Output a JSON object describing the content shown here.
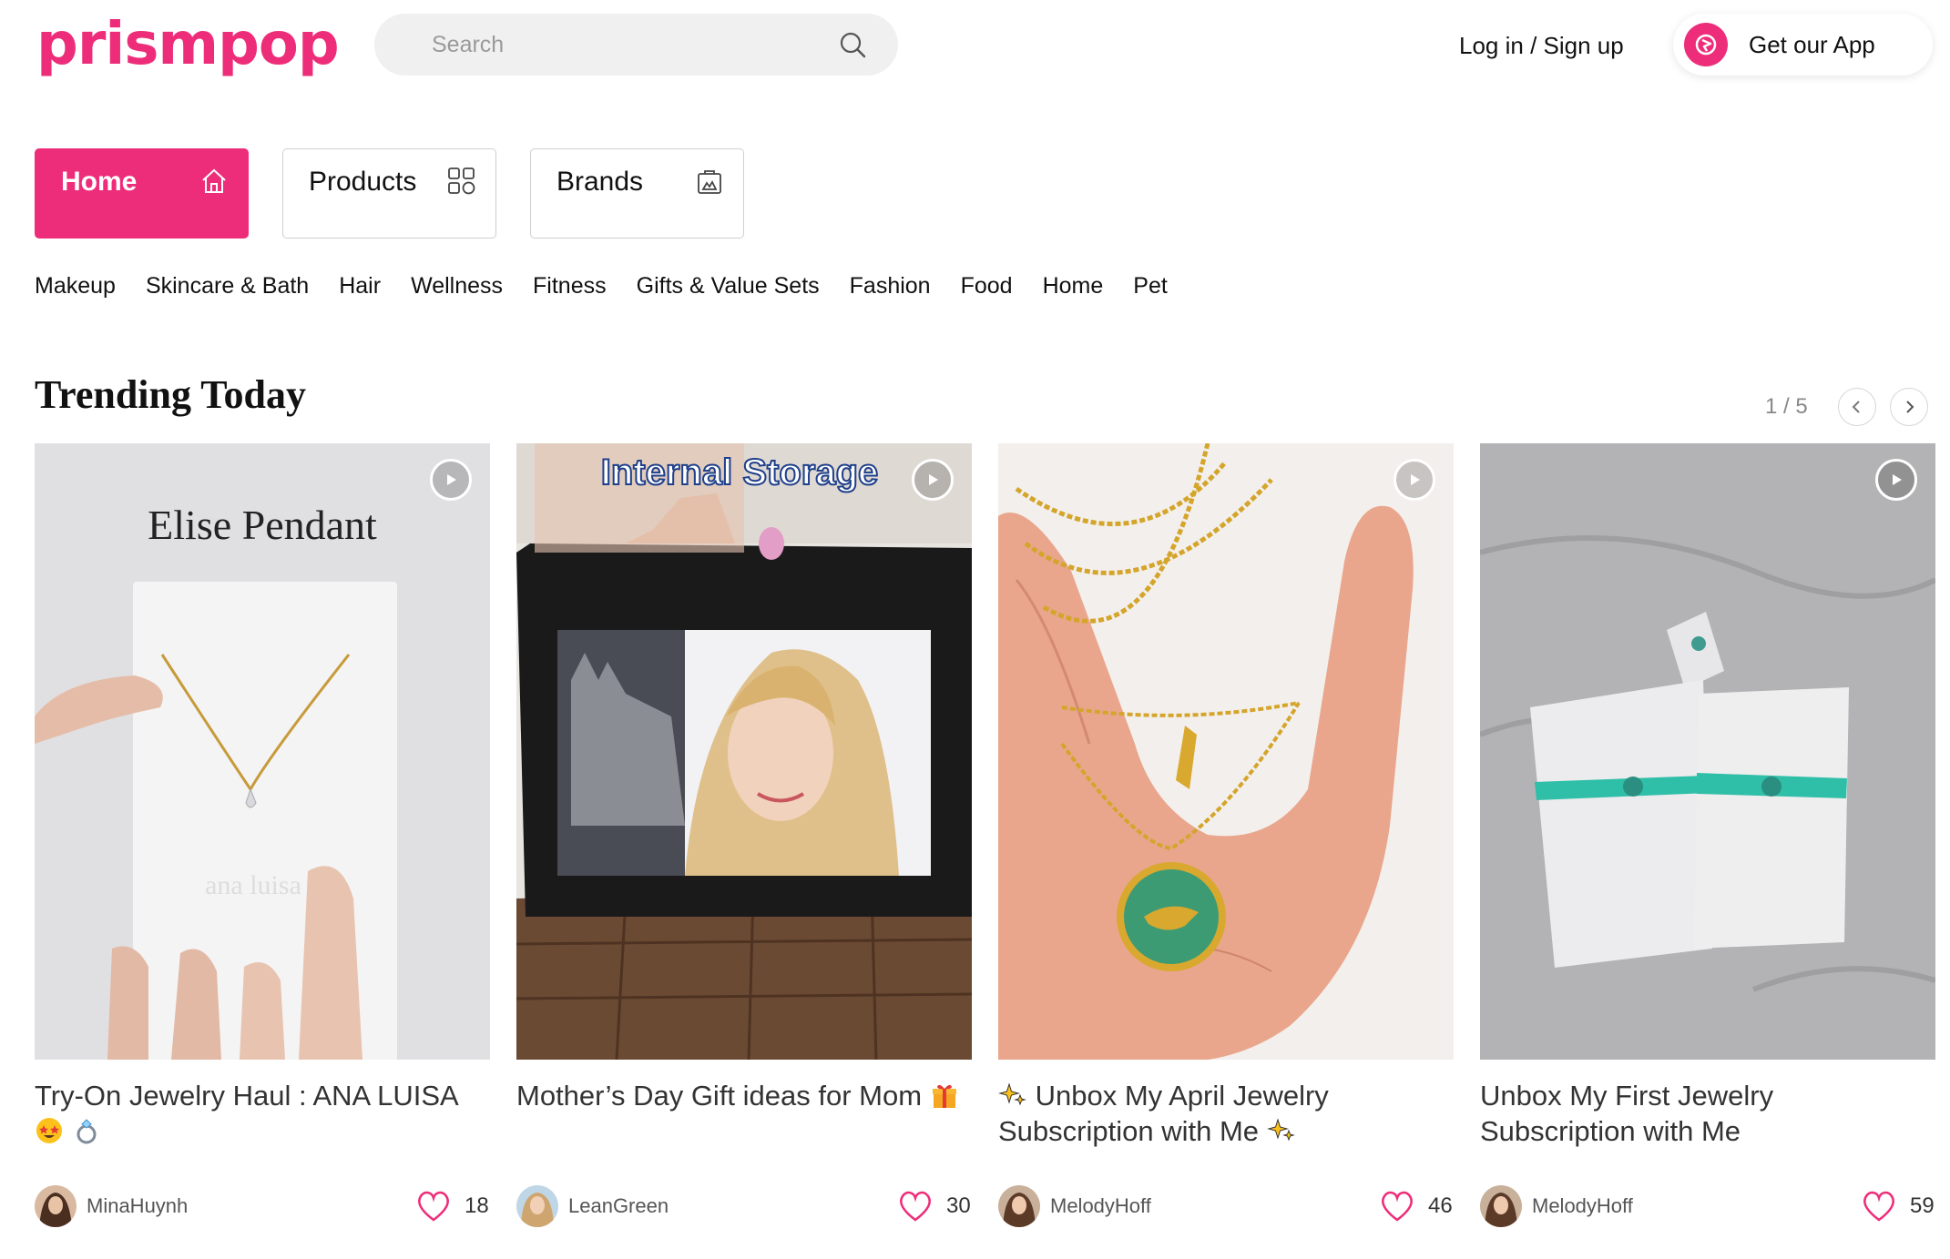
{
  "header": {
    "logo": "prismpop",
    "search_placeholder": "Search",
    "login_label": "Log in / Sign up",
    "get_app_label": "Get our App"
  },
  "nav": {
    "tabs": [
      {
        "label": "Home",
        "icon": "house-icon",
        "active": true
      },
      {
        "label": "Products",
        "icon": "grid-icon",
        "active": false
      },
      {
        "label": "Brands",
        "icon": "store-bag-icon",
        "active": false
      }
    ]
  },
  "categories": [
    "Makeup",
    "Skincare & Bath",
    "Hair",
    "Wellness",
    "Fitness",
    "Gifts & Value Sets",
    "Fashion",
    "Food",
    "Home",
    "Pet"
  ],
  "trending": {
    "title": "Trending Today",
    "pager": "1 / 5",
    "cards": [
      {
        "title": "Try-On Jewelry Haul : ANA LUISA",
        "emojis": [
          "star-struck-emoji",
          "ring-emoji"
        ],
        "overlay_text": "Elise Pendant",
        "card_text": "ana luisa",
        "user": "MinaHuynh",
        "likes": "18"
      },
      {
        "title": "Mother’s Day Gift ideas for Mom",
        "emojis": [
          "gift-emoji"
        ],
        "overlay_text": "Internal Storage",
        "user": "LeanGreen",
        "likes": "30"
      },
      {
        "title_prefix_emoji": "sparkles-emoji",
        "title": "Unbox My April Jewelry Subscription with Me",
        "emojis": [
          "sparkles-emoji"
        ],
        "user": "MelodyHoff",
        "likes": "46"
      },
      {
        "title": "Unbox My First Jewelry Subscription with Me",
        "emojis": [],
        "user": "MelodyHoff",
        "likes": "59"
      }
    ]
  },
  "colors": {
    "brand": "#ee2d7a",
    "text": "#111111",
    "muted": "#888888"
  }
}
